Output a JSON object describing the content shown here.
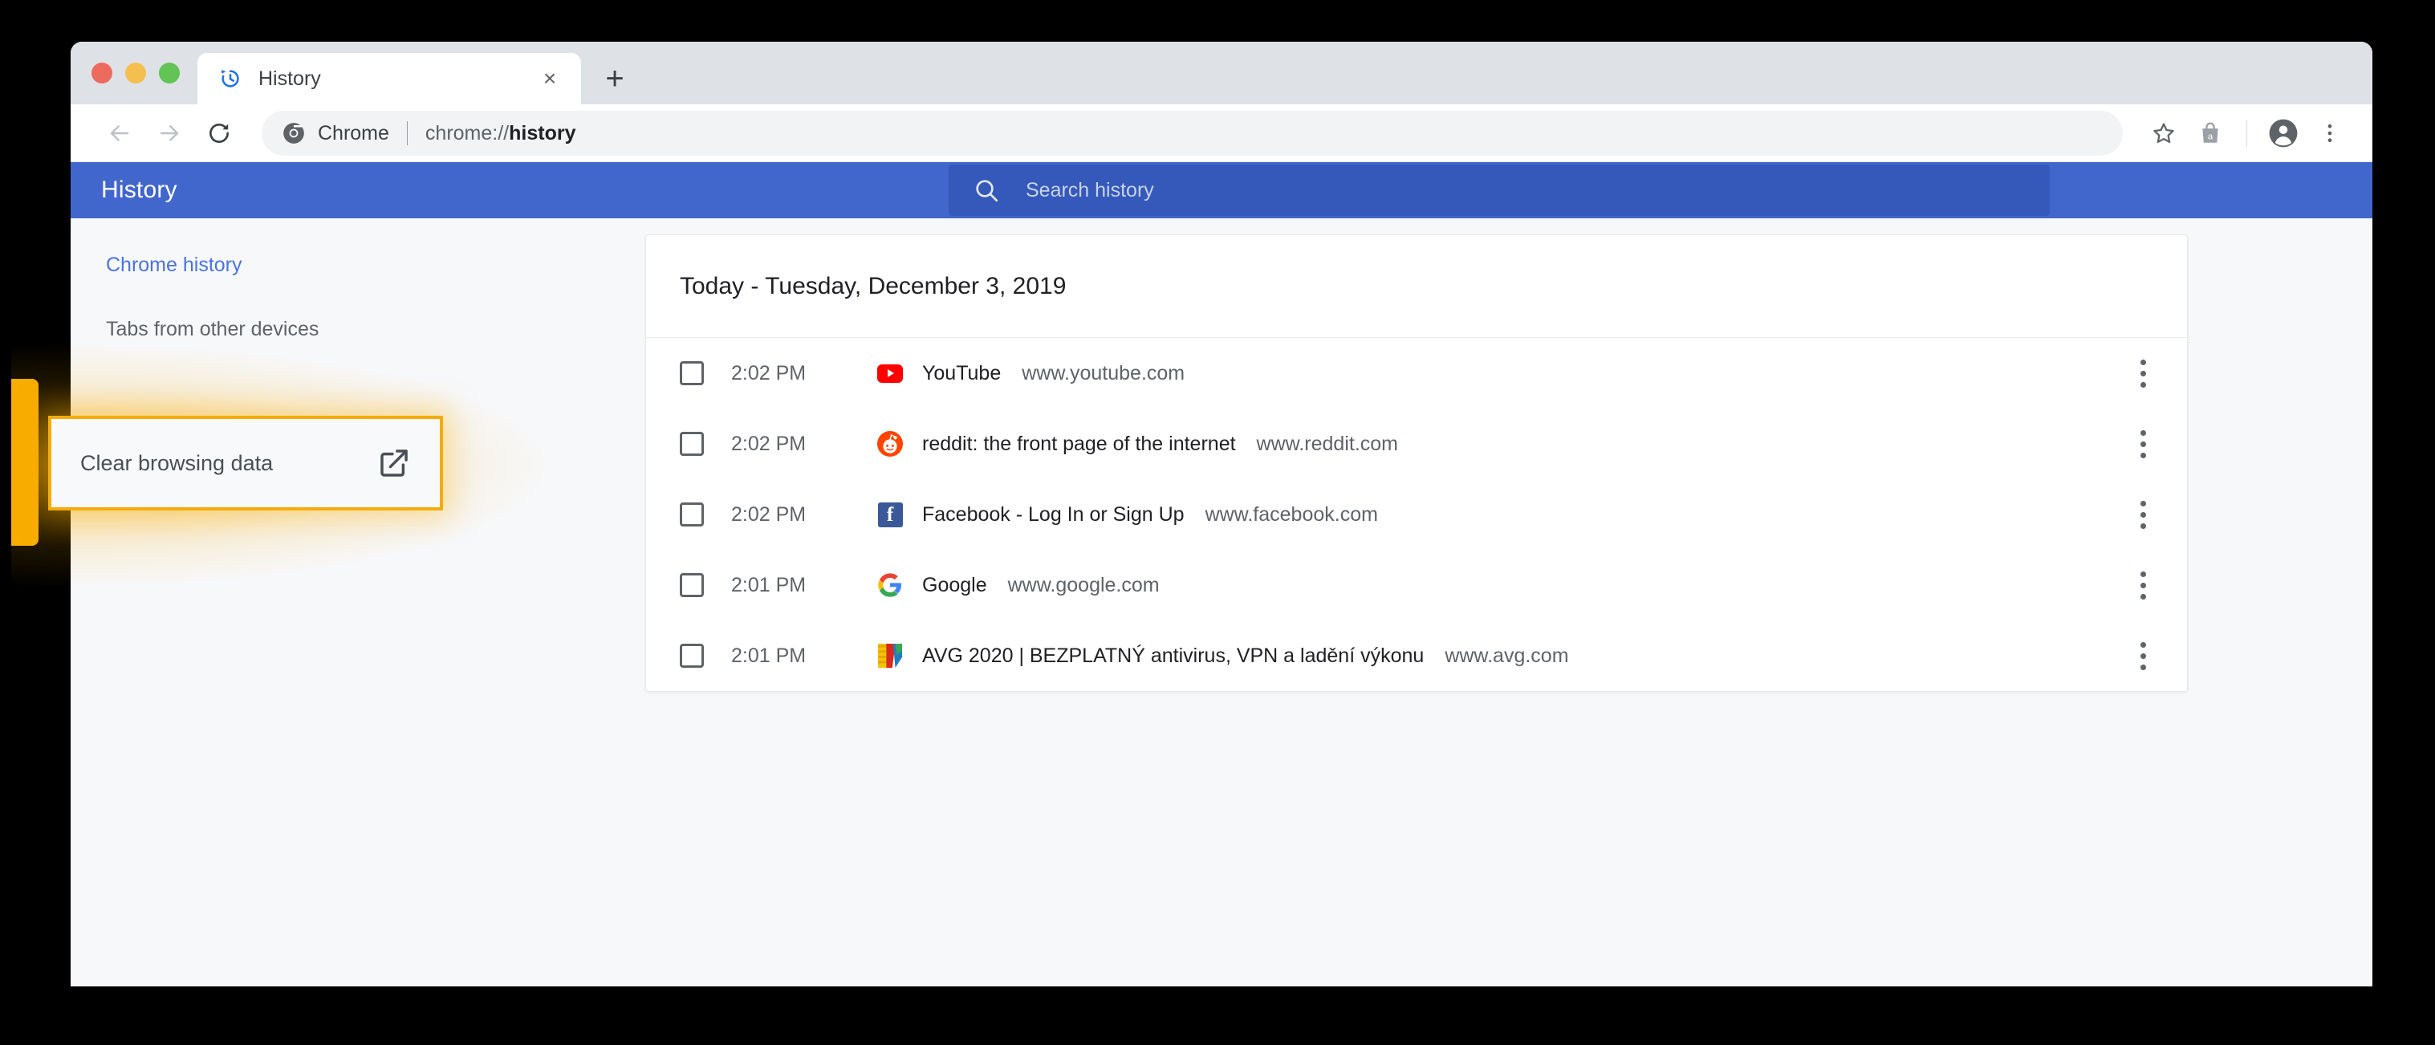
{
  "window": {
    "traffic_lights": [
      "close",
      "minimize",
      "maximize"
    ],
    "tab": {
      "title": "History",
      "favicon": "history-clock-icon",
      "close_label": "×"
    },
    "new_tab_label": "+"
  },
  "toolbar": {
    "back_icon": "arrow-left-icon",
    "forward_icon": "arrow-right-icon",
    "reload_icon": "reload-icon",
    "omnibox": {
      "site_icon": "chrome-logo-icon",
      "site_label": "Chrome",
      "url_prefix": "chrome://",
      "url_bold": "history",
      "full_url": "chrome://history"
    },
    "bookmark_icon": "star-icon",
    "extension_icon": "shopping-bag-icon",
    "profile_icon": "account-avatar-icon",
    "menu_icon": "three-dot-menu-icon"
  },
  "history_header": {
    "title": "History",
    "search_placeholder": "Search history",
    "search_value": "",
    "search_icon": "search-icon",
    "bg_color": "#4267CC",
    "search_bg_color": "#3459BA"
  },
  "sidebar": {
    "items": [
      {
        "label": "Chrome history",
        "active": true
      },
      {
        "label": "Tabs from other devices",
        "active": false
      }
    ]
  },
  "callout": {
    "label": "Clear browsing data",
    "icon": "external-link-icon",
    "border_color": "#F4AC0C",
    "glow_color": "#F9AD00"
  },
  "history_card": {
    "group_title": "Today - Tuesday, December 3, 2019",
    "rows": [
      {
        "time": "2:02 PM",
        "title": "YouTube",
        "url": "www.youtube.com",
        "favicon": "youtube-icon",
        "checked": false,
        "menu_icon": "three-dot-menu-icon"
      },
      {
        "time": "2:02 PM",
        "title": "reddit: the front page of the internet",
        "url": "www.reddit.com",
        "favicon": "reddit-icon",
        "checked": false,
        "menu_icon": "three-dot-menu-icon"
      },
      {
        "time": "2:02 PM",
        "title": "Facebook - Log In or Sign Up",
        "url": "www.facebook.com",
        "favicon": "facebook-icon",
        "checked": false,
        "menu_icon": "three-dot-menu-icon"
      },
      {
        "time": "2:01 PM",
        "title": "Google",
        "url": "www.google.com",
        "favicon": "google-icon",
        "checked": false,
        "menu_icon": "three-dot-menu-icon"
      },
      {
        "time": "2:01 PM",
        "title": "AVG 2020 | BEZPLATNÝ antivirus, VPN a ladění výkonu",
        "url": "www.avg.com",
        "favicon": "avg-icon",
        "checked": false,
        "menu_icon": "three-dot-menu-icon"
      }
    ]
  }
}
